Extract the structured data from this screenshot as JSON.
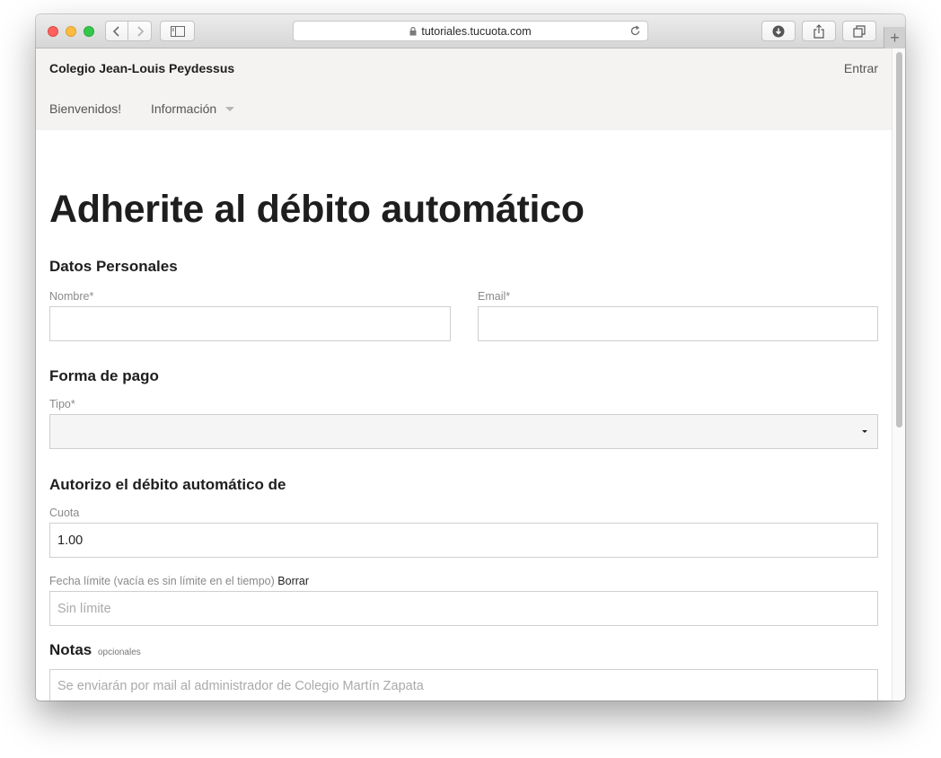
{
  "browser": {
    "url": "tutoriales.tucuota.com"
  },
  "site": {
    "brand": "Colegio Jean-Louis Peydessus",
    "login": "Entrar",
    "nav": {
      "welcome": "Bienvenidos!",
      "info": "Información"
    }
  },
  "form": {
    "title": "Adherite al débito automático",
    "personal": {
      "heading": "Datos Personales",
      "name_label": "Nombre*",
      "name_value": "",
      "email_label": "Email*",
      "email_value": ""
    },
    "payment": {
      "heading": "Forma de pago",
      "type_label": "Tipo*",
      "type_value": ""
    },
    "authorize": {
      "heading": "Autorizo el débito automático de",
      "quota_label": "Cuota",
      "quota_value": "1.00",
      "limit_label": "Fecha límite (vacía es sin límite en el tiempo)",
      "limit_clear": "Borrar",
      "limit_placeholder": "Sin límite"
    },
    "notes": {
      "heading": "Notas",
      "optional": "opcionales",
      "placeholder": "Se enviarán por mail al administrador de Colegio Martín Zapata"
    }
  }
}
